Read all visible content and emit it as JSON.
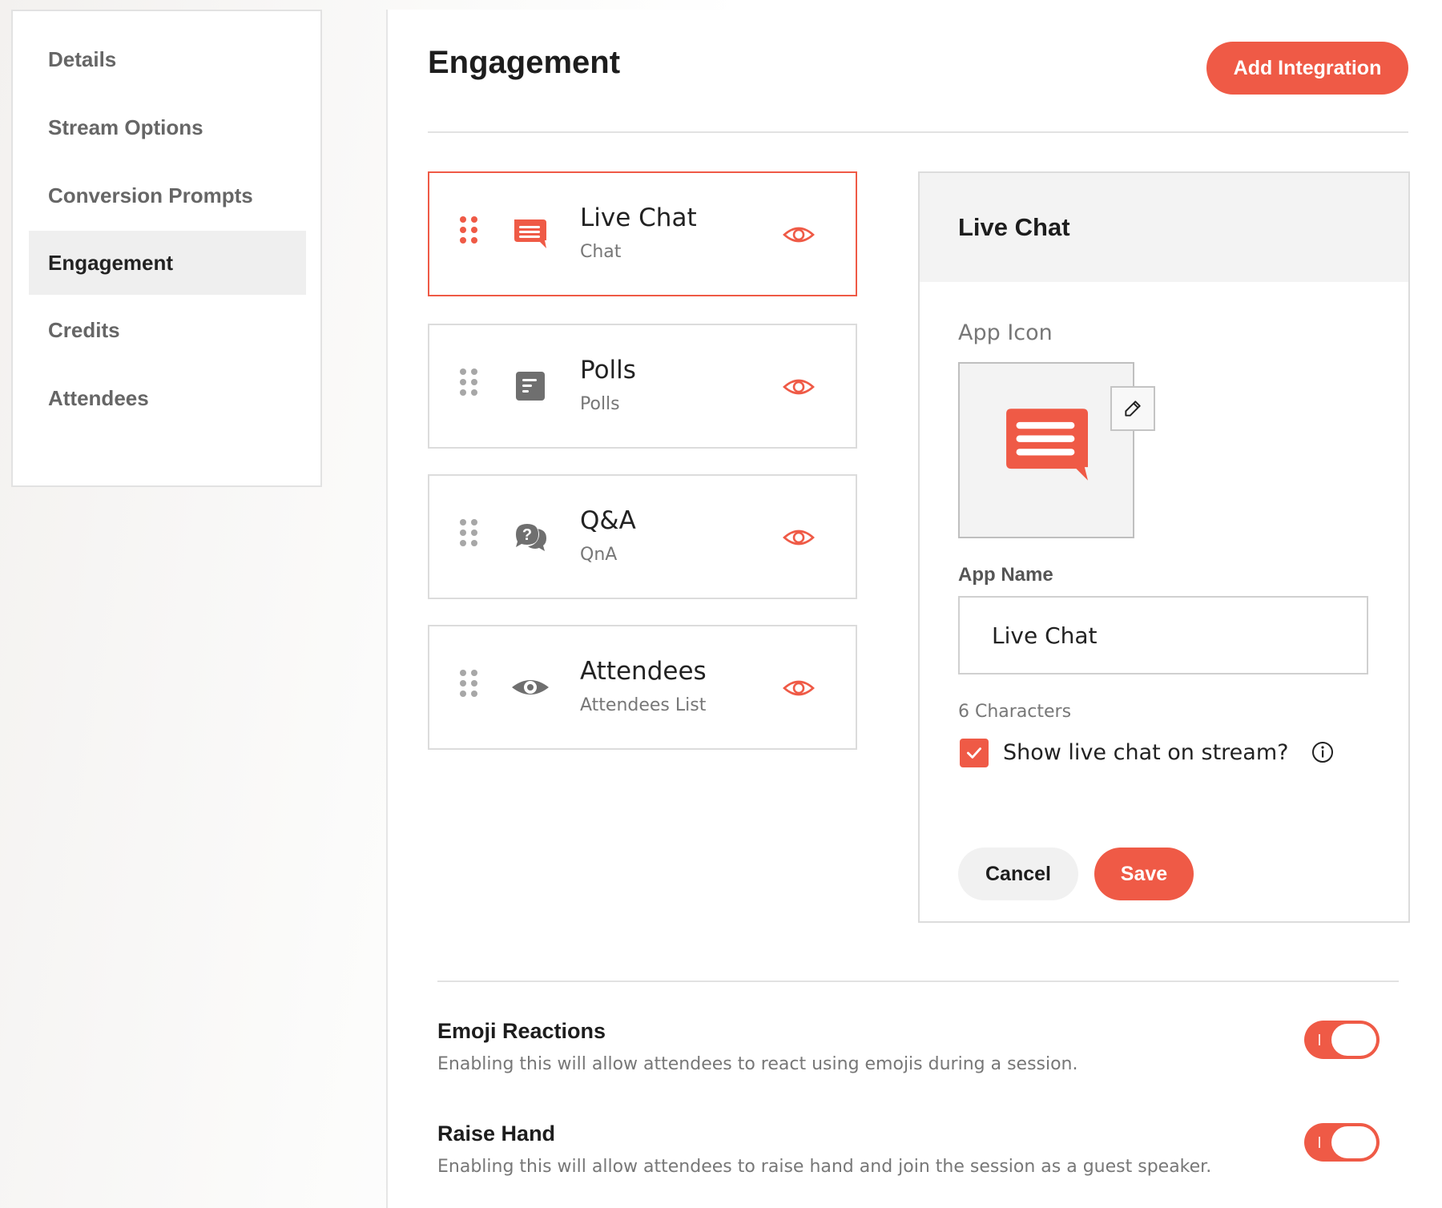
{
  "sidebar": {
    "items": [
      {
        "label": "Details"
      },
      {
        "label": "Stream Options"
      },
      {
        "label": "Conversion Prompts"
      },
      {
        "label": "Engagement",
        "active": true
      },
      {
        "label": "Credits"
      },
      {
        "label": "Attendees"
      }
    ]
  },
  "header": {
    "title": "Engagement",
    "add_label": "Add Integration"
  },
  "apps": [
    {
      "title": "Live Chat",
      "subtitle": "Chat",
      "icon": "chat-bubble-icon",
      "selected": true,
      "visible": true
    },
    {
      "title": "Polls",
      "subtitle": "Polls",
      "icon": "polls-icon",
      "selected": false,
      "visible": true
    },
    {
      "title": "Q&A",
      "subtitle": "QnA",
      "icon": "qna-icon",
      "selected": false,
      "visible": true
    },
    {
      "title": "Attendees",
      "subtitle": "Attendees List",
      "icon": "eye-icon",
      "selected": false,
      "visible": true
    }
  ],
  "detail": {
    "title": "Live Chat",
    "app_icon_label": "App Icon",
    "app_name_label": "App Name",
    "app_name_value": "Live Chat",
    "char_count": "6 Characters",
    "show_on_stream_label": "Show live chat on stream?",
    "show_on_stream_checked": true,
    "cancel_label": "Cancel",
    "save_label": "Save"
  },
  "features": [
    {
      "title": "Emoji Reactions",
      "description": "Enabling this will allow attendees to react using emojis during a session.",
      "enabled": true
    },
    {
      "title": "Raise Hand",
      "description": "Enabling this will allow attendees to raise hand and join the session as a guest speaker.",
      "enabled": true
    }
  ],
  "colors": {
    "accent": "#ef5a46",
    "muted_icon": "#6f6f6f",
    "grip_inactive": "#a7a7a7",
    "panel_header": "#f3f3f3"
  }
}
